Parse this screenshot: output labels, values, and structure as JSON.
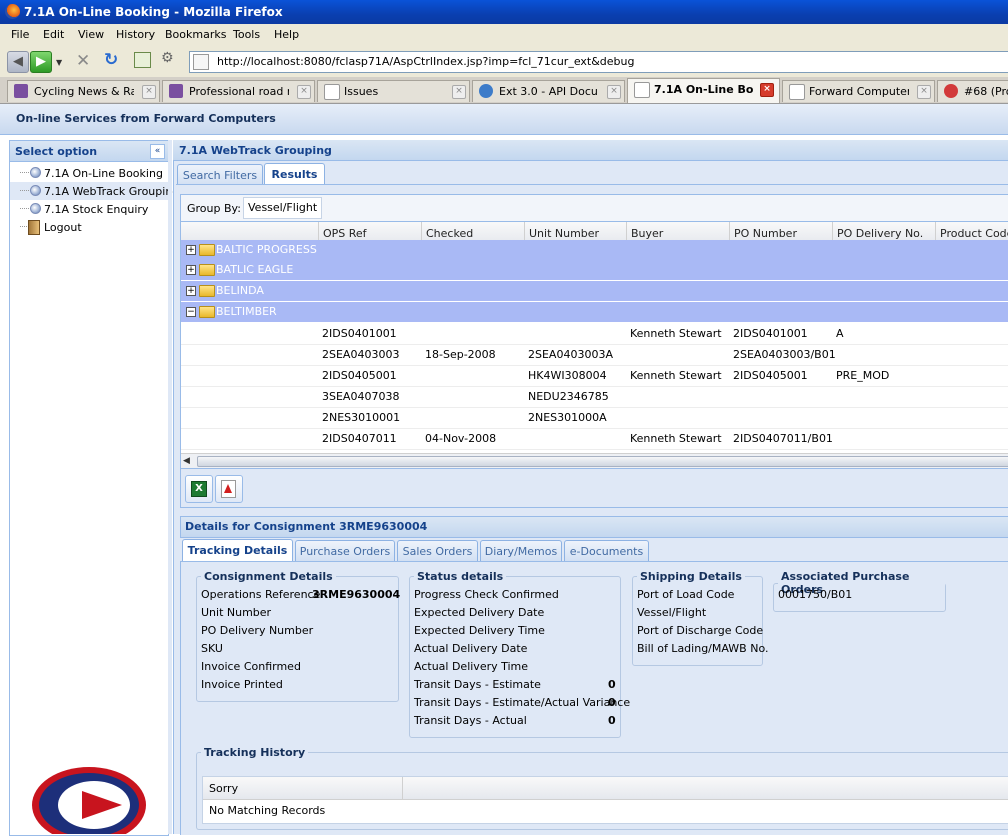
{
  "window": {
    "title": "7.1A On-Line Booking - Mozilla Firefox"
  },
  "menu": [
    "File",
    "Edit",
    "View",
    "History",
    "Bookmarks",
    "Tools",
    "Help"
  ],
  "url": "http://localhost:8080/fclasp71A/AspCtrlIndex.jsp?imp=fcl_71cur_ext&debug",
  "browser_tabs": [
    {
      "label": "Cycling News & Ra...",
      "favicon": "cycling-icon"
    },
    {
      "label": "Professional road r...",
      "favicon": "cycling-icon"
    },
    {
      "label": "Issues",
      "favicon": "page-icon"
    },
    {
      "label": "Ext 3.0 - API Docu...",
      "favicon": "ext-icon"
    },
    {
      "label": "7.1A On-Line Bo...",
      "favicon": "page-icon",
      "active": true
    },
    {
      "label": "Forward Computer...",
      "favicon": "page-icon"
    },
    {
      "label": "#68 (Pro",
      "favicon": "bug-icon"
    }
  ],
  "app": {
    "header": "On-line Services from Forward Computers"
  },
  "sidebar": {
    "title": "Select option",
    "items": [
      {
        "label": "7.1A On-Line Booking"
      },
      {
        "label": "7.1A WebTrack Grouping",
        "selected": true
      },
      {
        "label": "7.1A Stock Enquiry"
      },
      {
        "label": "Logout"
      }
    ]
  },
  "main": {
    "title": "7.1A WebTrack Grouping",
    "tabs": [
      {
        "label": "Search Filters"
      },
      {
        "label": "Results",
        "active": true
      }
    ],
    "group_by_label": "Group By:",
    "group_by_value": "Vessel/Flight",
    "columns": [
      "OPS Ref",
      "Checked",
      "Unit Number",
      "Buyer",
      "PO Number",
      "PO Delivery No.",
      "Product Code"
    ],
    "groups": [
      {
        "name": "BALTIC PROGRESS",
        "expanded": false
      },
      {
        "name": "BATLIC EAGLE",
        "expanded": false
      },
      {
        "name": "BELINDA",
        "expanded": false
      },
      {
        "name": "BELTIMBER",
        "expanded": true
      }
    ],
    "rows": [
      [
        "2IDS0401001",
        "",
        "",
        "Kenneth Stewart",
        "2IDS0401001",
        "A",
        ""
      ],
      [
        "2SEA0403003",
        "18-Sep-2008",
        "2SEA0403003A",
        "",
        "2SEA0403003/B01",
        "",
        ""
      ],
      [
        "2IDS0405001",
        "",
        "HK4WI308004",
        "Kenneth Stewart",
        "2IDS0405001",
        "PRE_MOD",
        ""
      ],
      [
        "3SEA0407038",
        "",
        "NEDU2346785",
        "",
        "",
        "",
        ""
      ],
      [
        "2NES3010001",
        "",
        "2NES301000A",
        "",
        "",
        "",
        ""
      ],
      [
        "2IDS0407011",
        "04-Nov-2008",
        "",
        "Kenneth Stewart",
        "2IDS0407011/B01",
        "",
        ""
      ]
    ]
  },
  "details": {
    "title": "Details for Consignment 3RME9630004",
    "tabs": [
      {
        "label": "Tracking Details",
        "active": true
      },
      {
        "label": "Purchase Orders"
      },
      {
        "label": "Sales Orders"
      },
      {
        "label": "Diary/Memos"
      },
      {
        "label": "e-Documents"
      }
    ],
    "consignment": {
      "legend": "Consignment Details",
      "fields": [
        {
          "label": "Operations Reference",
          "value": "3RME9630004"
        },
        {
          "label": "Unit Number",
          "value": ""
        },
        {
          "label": "PO Delivery Number",
          "value": ""
        },
        {
          "label": "SKU",
          "value": ""
        },
        {
          "label": "Invoice Confirmed",
          "value": ""
        },
        {
          "label": "Invoice Printed",
          "value": ""
        }
      ]
    },
    "status": {
      "legend": "Status details",
      "fields": [
        {
          "label": "Progress Check Confirmed",
          "value": ""
        },
        {
          "label": "Expected Delivery Date",
          "value": ""
        },
        {
          "label": "Expected Delivery Time",
          "value": ""
        },
        {
          "label": "Actual Delivery Date",
          "value": ""
        },
        {
          "label": "Actual Delivery Time",
          "value": ""
        },
        {
          "label": "Transit Days - Estimate",
          "value": "0"
        },
        {
          "label": "Transit Days - Estimate/Actual Variance",
          "value": "0"
        },
        {
          "label": "Transit Days - Actual",
          "value": "0"
        }
      ]
    },
    "shipping": {
      "legend": "Shipping Details",
      "fields": [
        {
          "label": "Port of Load Code"
        },
        {
          "label": "Vessel/Flight"
        },
        {
          "label": "Port of Discharge Code"
        },
        {
          "label": "Bill of Lading/MAWB No."
        }
      ]
    },
    "assoc_po": {
      "legend": "Associated Purchase Orders",
      "items": [
        "0001750/B01"
      ]
    },
    "history": {
      "legend": "Tracking History",
      "column": "Sorry",
      "empty": "No Matching Records"
    }
  },
  "colors": {
    "accent": "#15428b",
    "group_row": "#a9b9f5",
    "panel_bg": "#dfe8f6"
  }
}
